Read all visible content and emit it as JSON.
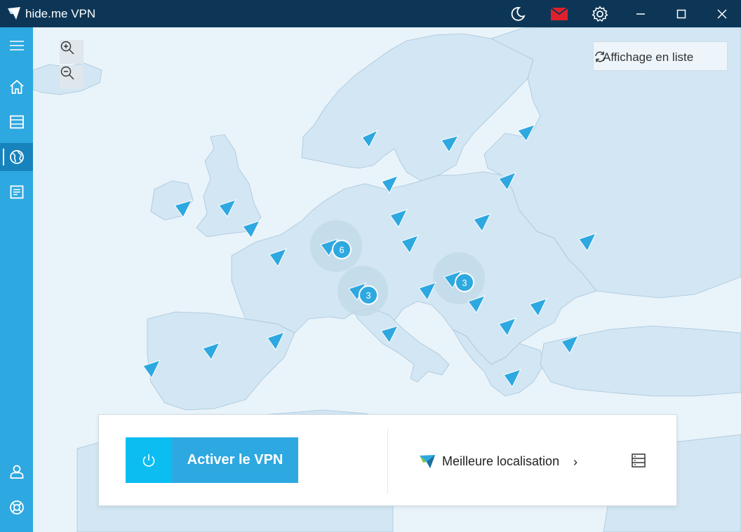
{
  "window": {
    "title": "hide.me VPN",
    "icons": [
      "logo-icon",
      "moon-icon",
      "mail-icon",
      "gear-icon",
      "minimize-icon",
      "maximize-icon",
      "close-icon"
    ],
    "mail_color": "#e0202c"
  },
  "sidebar": {
    "items": [
      {
        "name": "menu-icon",
        "active": false
      },
      {
        "name": "home-icon",
        "active": false
      },
      {
        "name": "server-list-icon",
        "active": false
      },
      {
        "name": "globe-icon",
        "active": true
      },
      {
        "name": "log-icon",
        "active": false
      },
      {
        "name": "user-icon",
        "active": false
      },
      {
        "name": "support-icon",
        "active": false
      }
    ]
  },
  "map": {
    "zoom_in_icon": "zoom-in-icon",
    "zoom_out_icon": "zoom-out-icon",
    "list_toggle_label": "Affichage en liste",
    "list_toggle_icon": "refresh-icon",
    "clusters": [
      {
        "label": "6"
      },
      {
        "label": "3"
      },
      {
        "label": "3"
      }
    ],
    "marker_color": "#2ea8e0"
  },
  "connect_panel": {
    "power_icon": "power-icon",
    "activate_label": "Activer le VPN",
    "location_icon": "hide-me-logo-icon",
    "location_label": "Meilleure localisation",
    "location_chevron": "›",
    "server_icon": "server-icon"
  },
  "colors": {
    "titlebar": "#0d3656",
    "sidebar": "#2ea8e0",
    "sidebar_active": "#1683bc",
    "power_button": "#0bbdf1",
    "activate_button": "#2ea8e0"
  }
}
